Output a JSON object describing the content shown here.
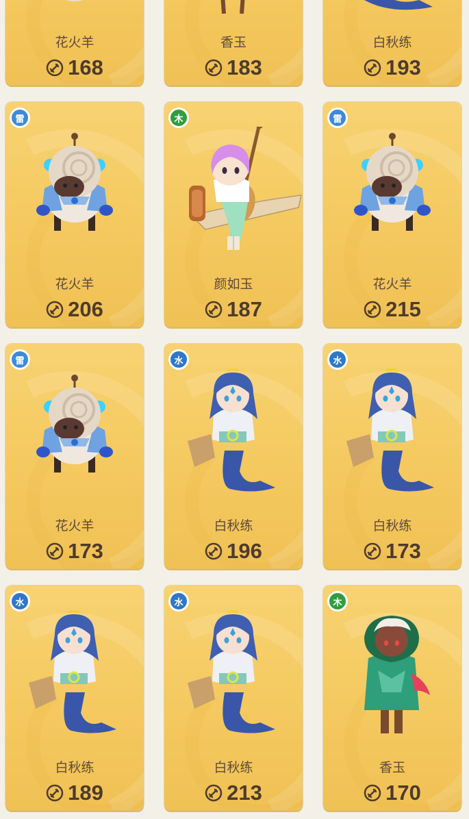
{
  "cards": [
    {
      "name": "花火羊",
      "power": "168",
      "element": "",
      "element_class": "",
      "character": "sheep-character"
    },
    {
      "name": "香玉",
      "power": "183",
      "element": "",
      "element_class": "",
      "character": "xiangyu-character"
    },
    {
      "name": "白秋练",
      "power": "193",
      "element": "",
      "element_class": "",
      "character": "mermaid-character"
    },
    {
      "name": "花火羊",
      "power": "206",
      "element": "雷",
      "element_class": "thunder",
      "character": "sheep-character"
    },
    {
      "name": "颜如玉",
      "power": "187",
      "element": "木",
      "element_class": "wood",
      "character": "lute-girl-character"
    },
    {
      "name": "花火羊",
      "power": "215",
      "element": "雷",
      "element_class": "thunder",
      "character": "sheep-character"
    },
    {
      "name": "花火羊",
      "power": "173",
      "element": "雷",
      "element_class": "thunder",
      "character": "sheep-character"
    },
    {
      "name": "白秋练",
      "power": "196",
      "element": "水",
      "element_class": "water",
      "character": "mermaid-character"
    },
    {
      "name": "白秋练",
      "power": "173",
      "element": "水",
      "element_class": "water",
      "character": "mermaid-character"
    },
    {
      "name": "白秋练",
      "power": "189",
      "element": "水",
      "element_class": "water",
      "character": "mermaid-character"
    },
    {
      "name": "白秋练",
      "power": "213",
      "element": "水",
      "element_class": "water",
      "character": "mermaid-character"
    },
    {
      "name": "香玉",
      "power": "170",
      "element": "木",
      "element_class": "wood",
      "character": "xiangyu-character"
    }
  ]
}
